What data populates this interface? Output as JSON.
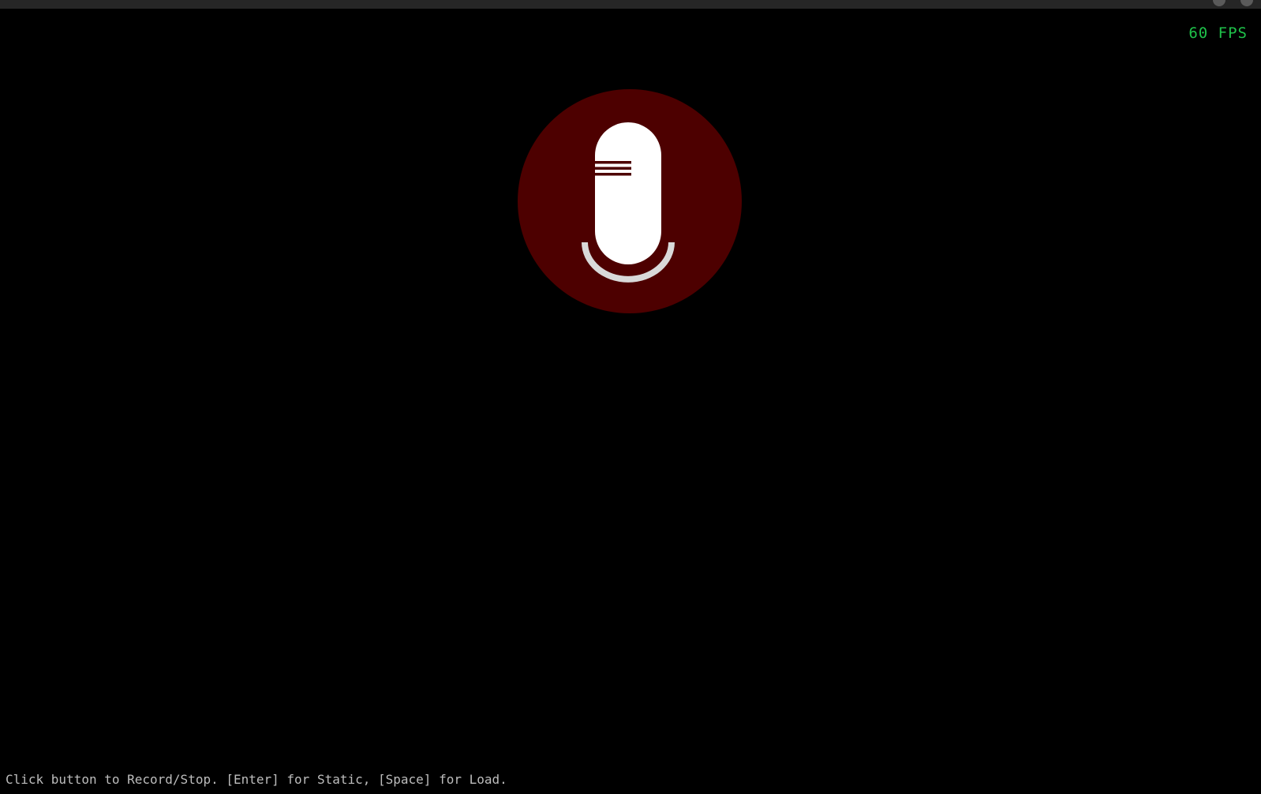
{
  "app": {
    "fps_label": "60 FPS",
    "hint": "Click button to Record/Stop. [Enter] for Static, [Space] for Load."
  },
  "record_button": {
    "icon": "microphone-icon",
    "state": "idle"
  },
  "colors": {
    "background": "#000000",
    "button_fill": "#4d0000",
    "mic_body": "#ffffff",
    "mic_stand": "#d9d9d9",
    "fps_text": "#1fc24a",
    "hint_text": "#bdbdbd"
  }
}
